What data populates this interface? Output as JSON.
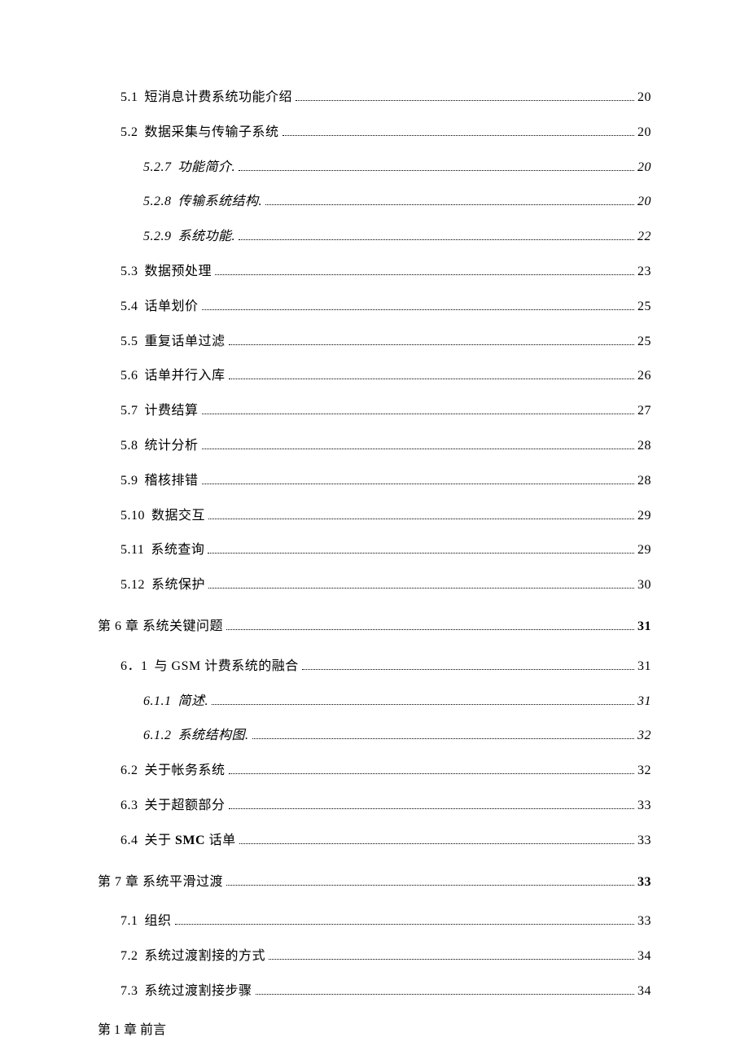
{
  "toc": [
    {
      "level": 2,
      "number": "5.1",
      "title": "短消息计费系统功能介绍",
      "page": "20",
      "titleBold": false,
      "pageBold": false
    },
    {
      "level": 2,
      "number": "5.2",
      "title": "数据采集与传输子系统",
      "page": "20",
      "titleBold": false,
      "pageBold": false
    },
    {
      "level": 3,
      "number": "5.2.7",
      "title": "功能简介.",
      "page": "20",
      "titleBold": false,
      "pageBold": false
    },
    {
      "level": 3,
      "number": "5.2.8",
      "title": "传输系统结构.",
      "page": "20",
      "titleBold": false,
      "pageBold": false
    },
    {
      "level": 3,
      "number": "5.2.9",
      "title": "系统功能.",
      "page": "22",
      "titleBold": false,
      "pageBold": false
    },
    {
      "level": 2,
      "number": "5.3",
      "title": "数据预处理",
      "page": "23",
      "titleBold": false,
      "pageBold": false
    },
    {
      "level": 2,
      "number": "5.4",
      "title": "话单划价",
      "page": "25",
      "titleBold": false,
      "pageBold": false
    },
    {
      "level": 2,
      "number": "5.5",
      "title": "重复话单过滤",
      "page": "25",
      "titleBold": false,
      "pageBold": false
    },
    {
      "level": 2,
      "number": "5.6",
      "title": "话单并行入库",
      "page": "26",
      "titleBold": false,
      "pageBold": false
    },
    {
      "level": 2,
      "number": "5.7",
      "title": "计费结算",
      "page": "27",
      "titleBold": false,
      "pageBold": false
    },
    {
      "level": 2,
      "number": "5.8",
      "title": "统计分析",
      "page": "28",
      "titleBold": false,
      "pageBold": false
    },
    {
      "level": 2,
      "number": "5.9",
      "title": "稽核排错",
      "page": "28",
      "titleBold": false,
      "pageBold": false
    },
    {
      "level": 2,
      "number": "5.10",
      "title": "数据交互",
      "page": "29",
      "titleBold": false,
      "pageBold": false
    },
    {
      "level": 2,
      "number": "5.11",
      "title": "系统查询",
      "page": "29",
      "titleBold": false,
      "pageBold": false
    },
    {
      "level": 2,
      "number": "5.12",
      "title": "系统保护",
      "page": "30",
      "titleBold": false,
      "pageBold": false
    },
    {
      "level": 1,
      "number": "",
      "title": "第 6 章 系统关键问题",
      "page": "31",
      "titleBold": false,
      "pageBold": true,
      "chapter": true
    },
    {
      "level": 2,
      "number": "6．1",
      "title": "与 GSM 计费系统的融合",
      "page": "31",
      "titleBold": false,
      "pageBold": false
    },
    {
      "level": 3,
      "number": "6.1.1",
      "title": "简述.",
      "page": "31",
      "titleBold": false,
      "pageBold": false
    },
    {
      "level": 3,
      "number": "6.1.2",
      "title": "系统结构图.",
      "page": "32",
      "titleBold": false,
      "pageBold": false
    },
    {
      "level": 2,
      "number": "6.2",
      "title": "关于帐务系统",
      "page": "32",
      "titleBold": false,
      "pageBold": false
    },
    {
      "level": 2,
      "number": "6.3",
      "title": "关于超额部分",
      "page": "33",
      "titleBold": false,
      "pageBold": false
    },
    {
      "level": 2,
      "number": "6.4",
      "title": "关于 <b>SMC</b> 话单",
      "page": "33",
      "titleBold": false,
      "pageBold": false,
      "html": true
    },
    {
      "level": 1,
      "number": "",
      "title": "第 7 章 系统平滑过渡",
      "page": "33",
      "titleBold": false,
      "pageBold": true,
      "chapter": true
    },
    {
      "level": 2,
      "number": "7.1",
      "title": "组织",
      "page": "33",
      "titleBold": false,
      "pageBold": false
    },
    {
      "level": 2,
      "number": "7.2",
      "title": "系统过渡割接的方式",
      "page": "34",
      "titleBold": false,
      "pageBold": false
    },
    {
      "level": 2,
      "number": "7.3",
      "title": "系统过渡割接步骤",
      "page": "34",
      "titleBold": false,
      "pageBold": false
    }
  ],
  "heading": "第 1 章 前言"
}
